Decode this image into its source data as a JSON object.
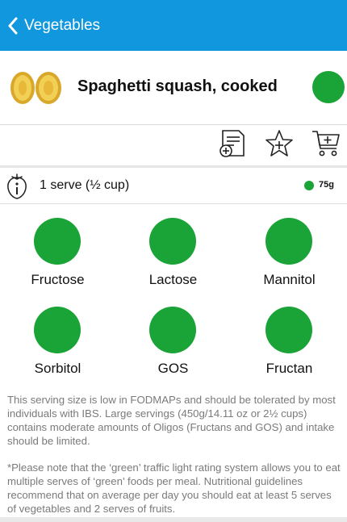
{
  "nav": {
    "back_label": "Vegetables"
  },
  "food": {
    "name": "Spaghetti squash, cooked",
    "rating_color": "#1aa336"
  },
  "actions": [
    {
      "icon": "add-to-list-icon"
    },
    {
      "icon": "add-to-favourites-icon"
    },
    {
      "icon": "add-to-cart-icon"
    }
  ],
  "serving": {
    "label": "1 serve (½ cup)",
    "weight": "75g",
    "rating_color": "#1aa336"
  },
  "fodmaps": [
    {
      "name": "Fructose",
      "rating_color": "#1aa336"
    },
    {
      "name": "Lactose",
      "rating_color": "#1aa336"
    },
    {
      "name": "Mannitol",
      "rating_color": "#1aa336"
    },
    {
      "name": "Sorbitol",
      "rating_color": "#1aa336"
    },
    {
      "name": "GOS",
      "rating_color": "#1aa336"
    },
    {
      "name": "Fructan",
      "rating_color": "#1aa336"
    }
  ],
  "notes": {
    "serving_note": "This serving size  is low in FODMAPs and should be tolerated by most individuals with IBS. Large servings (450g/14.11 oz or 2½ cups) contains moderate amounts of Oligos (Fructans and GOS) and intake should be limited.",
    "traffic_note": "*Please note that the ‘green’ traffic light rating system allows you to eat multiple serves of ‘green’ foods per meal.  Nutritional guidelines recommend that on average per day you should eat at least 5 serves of vegetables and 2 serves of fruits."
  },
  "colors": {
    "nav_bg": "#1197dd",
    "green": "#1aa336"
  }
}
